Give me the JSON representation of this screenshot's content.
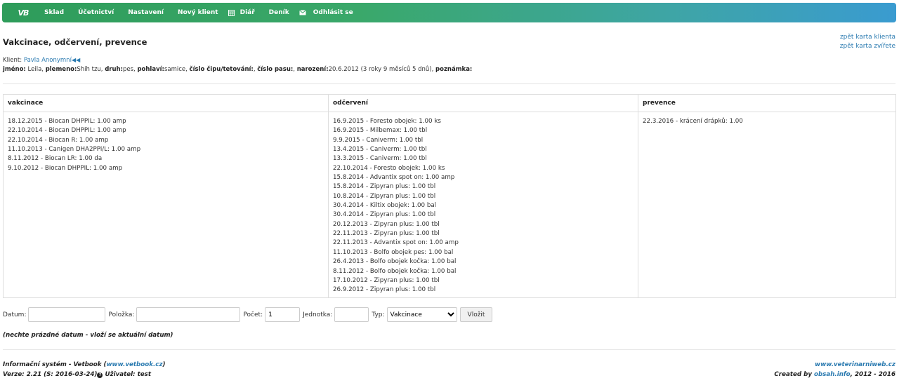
{
  "nav": {
    "logo": "VB",
    "items": [
      "Sklad",
      "Účetnictví",
      "Nastavení",
      "Nový klient"
    ],
    "diar": "Diář",
    "denik": "Deník",
    "logout": "Odhlásit se"
  },
  "page": {
    "title": "Vakcinace, odčervení, prevence",
    "back_links": [
      "zpět karta klienta",
      "zpět karta zvířete"
    ]
  },
  "client": {
    "label": "Klient:",
    "name": "Pavla Anonymní"
  },
  "pet": {
    "name_label": "jméno:",
    "name": "Leila,",
    "breed_label": "plemeno:",
    "breed": "Shih tzu,",
    "species_label": "druh:",
    "species": "pes,",
    "sex_label": "pohlaví:",
    "sex": "samice,",
    "chip_label": "číslo čipu/tetování:",
    "chip": ",",
    "passport_label": "číslo pasu:",
    "passport": ",",
    "birth_label": "narození:",
    "birth": "20.6.2012 (3 roky 9 měsíců 5 dnů),",
    "note_label": "poznámka:"
  },
  "table": {
    "headers": [
      "vakcinace",
      "odčervení",
      "prevence"
    ],
    "vakcinace": [
      "18.12.2015 - Biocan DHPPIL: 1.00 amp",
      "22.10.2014 - Biocan DHPPIL: 1.00 amp",
      "22.10.2014 - Biocan R: 1.00 amp",
      "11.10.2013 - Canigen DHA2PPi/L: 1.00 amp",
      "8.11.2012 - Biocan LR: 1.00 da",
      "9.10.2012 - Biocan DHPPIL: 1.00 amp"
    ],
    "odcerveni": [
      "16.9.2015 - Foresto obojek: 1.00 ks",
      "16.9.2015 - Milbemax: 1.00 tbl",
      "9.9.2015 - Caniverm: 1.00 tbl",
      "13.4.2015 - Caniverm: 1.00 tbl",
      "13.3.2015 - Caniverm: 1.00 tbl",
      "22.10.2014 - Foresto obojek: 1.00 ks",
      "15.8.2014 - Advantix spot on: 1.00 amp",
      "15.8.2014 - Zipyran plus: 1.00 tbl",
      "10.8.2014 - Zipyran plus: 1.00 tbl",
      "30.4.2014 - Kiltix obojek: 1.00 bal",
      "30.4.2014 - Zipyran plus: 1.00 tbl",
      "20.12.2013 - Zipyran plus: 1.00 tbl",
      "22.11.2013 - Zipyran plus: 1.00 tbl",
      "22.11.2013 - Advantix spot on: 1.00 amp",
      "11.10.2013 - Bolfo obojek pes: 1.00 bal",
      "26.4.2013 - Bolfo obojek kočka: 1.00 bal",
      "8.11.2012 - Bolfo obojek kočka: 1.00 bal",
      "17.10.2012 - Zipyran plus: 1.00 tbl",
      "26.9.2012 - Zipyran plus: 1.00 tbl"
    ],
    "prevence": [
      "22.3.2016 - krácení drápků: 1.00"
    ]
  },
  "form": {
    "date_label": "Datum:",
    "date_value": "",
    "item_label": "Položka:",
    "item_value": "",
    "count_label": "Počet:",
    "count_value": "1",
    "unit_label": "Jednotka:",
    "unit_value": "",
    "type_label": "Typ:",
    "type_selected": "Vakcinace",
    "submit_label": "Vložit"
  },
  "hint": "(nechte prázdné datum - vloží se aktuální datum)",
  "footer": {
    "left_line1_prefix": "Informační systém - Vetbook (",
    "left_line1_link": "www.vetbook.cz",
    "left_line1_suffix": ")",
    "left_line2_version": "Verze: 2.21 (S: 2016-03-24)",
    "left_line2_user": " Uživatel: test",
    "right_line1_link": "www.veterinarniweb.cz",
    "right_line2_prefix": "Created by ",
    "right_line2_link": "obsah.info",
    "right_line2_suffix": ", 2012 - 2016"
  }
}
